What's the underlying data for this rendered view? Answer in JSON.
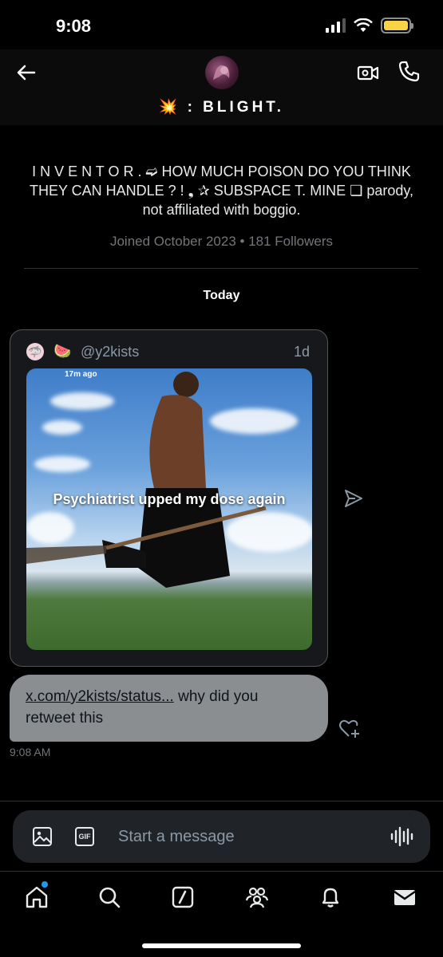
{
  "status_bar": {
    "time": "9:08"
  },
  "header": {
    "name_emoji": "💥",
    "name": ": BLIGHT."
  },
  "profile": {
    "bio": "I N V E N T O R . ➫ HOW MUCH POISON DO YOU THINK THEY CAN HANDLE ? ! ❟ ✰ SUBSPACE T. MINE ❏ parody, not affiliated with boggio.",
    "joined": "Joined October 2023 • 181 Followers"
  },
  "conversation": {
    "date_separator": "Today",
    "tweet_card": {
      "avatar_emoji": "🦈",
      "emoji": "🍉",
      "handle": "@y2kists",
      "time": "1d",
      "media_stamp": "17m ago",
      "media_caption": "Psychiatrist upped my dose again"
    },
    "message": {
      "link_text": "x.com/y2kists/status...",
      "text": " why did you retweet this",
      "timestamp": "9:08 AM"
    }
  },
  "compose": {
    "placeholder": "Start a message",
    "gif_label": "GIF"
  },
  "bottom_nav": {
    "items": [
      "home-icon",
      "search-icon",
      "grok-icon",
      "communities-icon",
      "notifications-icon",
      "messages-icon"
    ]
  },
  "colors": {
    "accent": "#1d9bf0",
    "bubble": "#8b8e91",
    "battery": "#f7d346"
  }
}
